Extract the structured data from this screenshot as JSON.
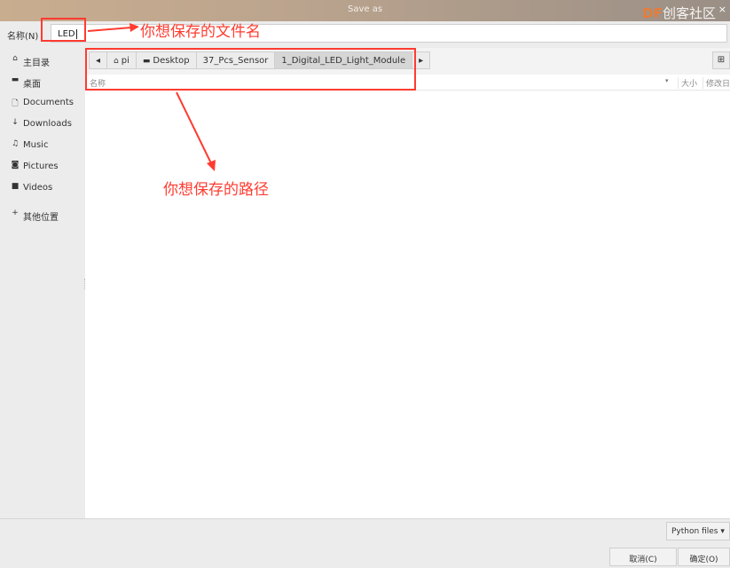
{
  "window": {
    "title": "Save as",
    "close": "×",
    "watermark_brand": "DF",
    "watermark_text": "创客社区"
  },
  "name_field": {
    "label": "名称(N)",
    "value": "LED"
  },
  "sidebar": {
    "items": [
      {
        "label": "主目录",
        "icon": "home-icon",
        "glyph": "⌂"
      },
      {
        "label": "桌面",
        "icon": "folder-icon",
        "glyph": "▬"
      },
      {
        "label": "Documents",
        "icon": "document-icon",
        "glyph": "🗋"
      },
      {
        "label": "Downloads",
        "icon": "download-icon",
        "glyph": "↓"
      },
      {
        "label": "Music",
        "icon": "music-icon",
        "glyph": "♫"
      },
      {
        "label": "Pictures",
        "icon": "camera-icon",
        "glyph": "◙"
      },
      {
        "label": "Videos",
        "icon": "video-icon",
        "glyph": "■"
      },
      {
        "label": "其他位置",
        "icon": "plus-icon",
        "glyph": "+"
      }
    ]
  },
  "pathbar": {
    "back": "◂",
    "forward": "▸",
    "segments": [
      {
        "label": "pi",
        "icon": "home-icon",
        "glyph": "⌂"
      },
      {
        "label": "Desktop",
        "icon": "folder-icon",
        "glyph": "▬"
      },
      {
        "label": "37_Pcs_Sensor"
      },
      {
        "label": "1_Digital_LED_Light_Module"
      }
    ],
    "new_folder_glyph": "⊞"
  },
  "columns": {
    "name": "名称",
    "sort": "▾",
    "size": "大小",
    "modified": "修改日"
  },
  "footer": {
    "filter": "Python files ▾",
    "cancel": "取消(C)",
    "ok": "确定(O)"
  },
  "annotations": {
    "filename_hint": "你想保存的文件名",
    "path_hint": "你想保存的路径",
    "color": "#ff3b30"
  }
}
